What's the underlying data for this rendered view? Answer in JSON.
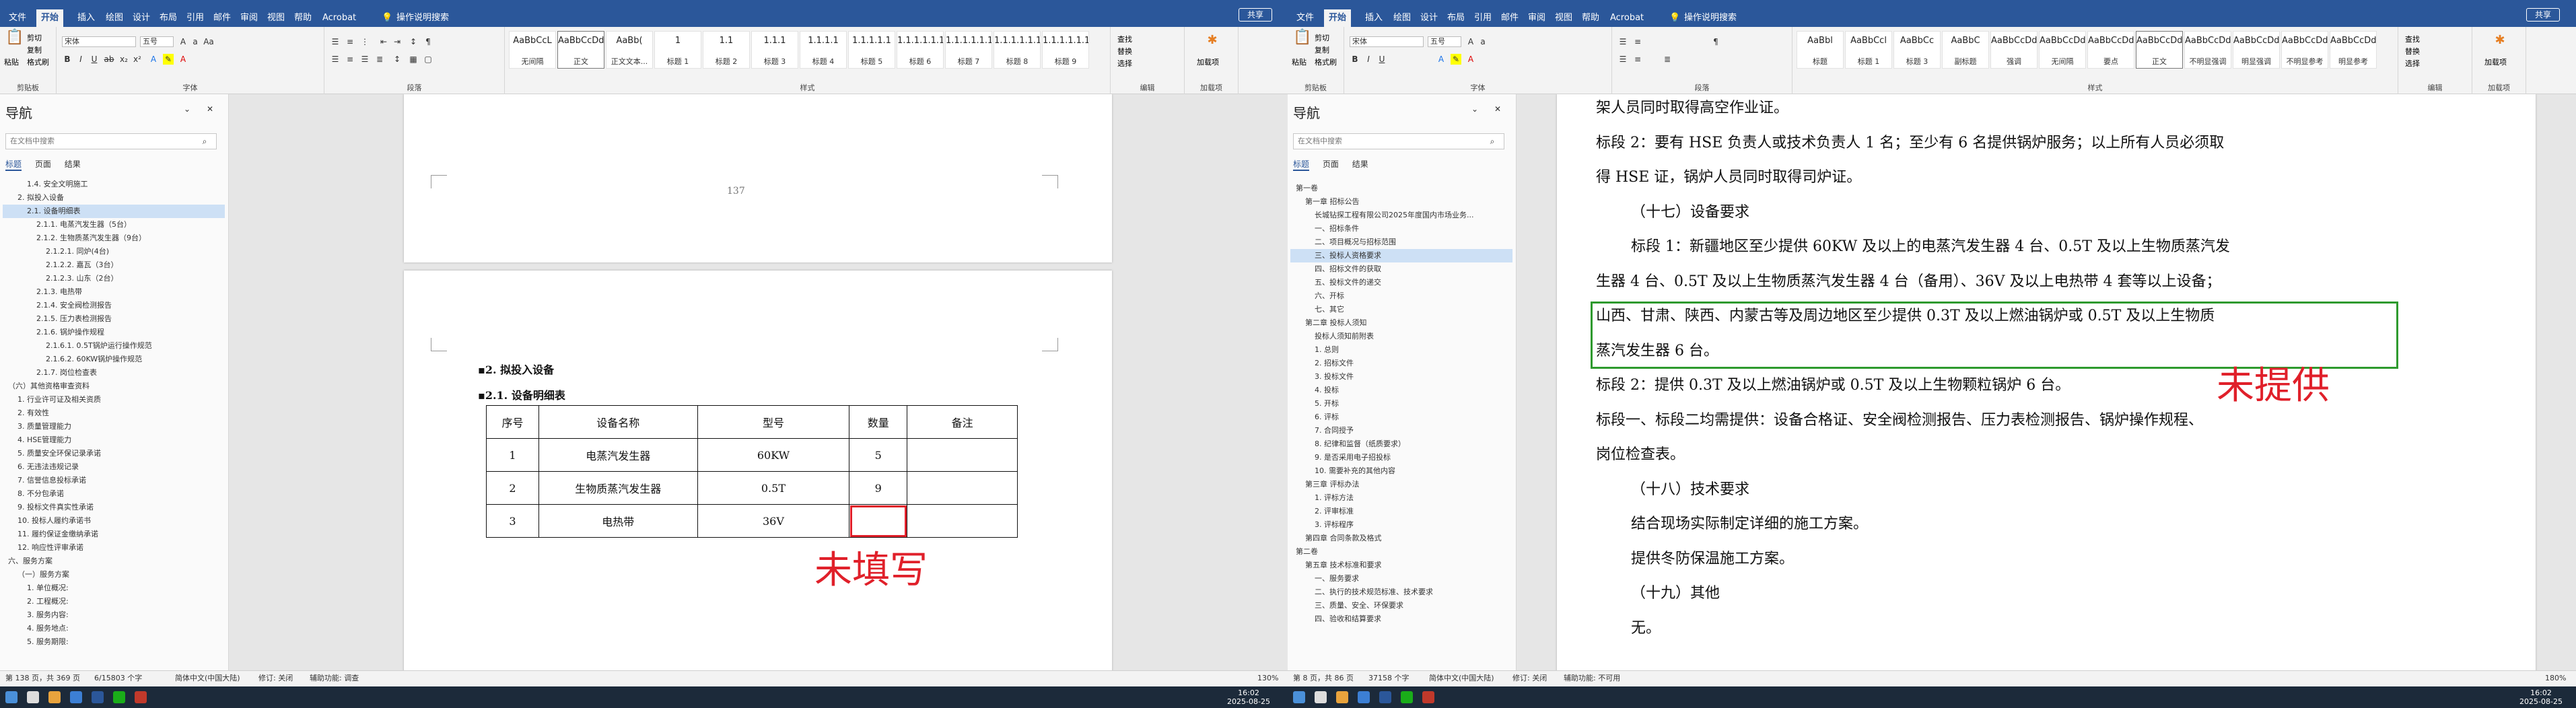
{
  "menu": {
    "tabs": [
      "文件",
      "开始",
      "插入",
      "绘图",
      "设计",
      "布局",
      "引用",
      "邮件",
      "审阅",
      "视图",
      "帮助",
      "Acrobat"
    ],
    "search_hint": "操作说明搜索",
    "share": "共享"
  },
  "ribbon": {
    "clipboard": {
      "paste": "粘贴",
      "cut": "剪切",
      "copy": "复制",
      "format_painter": "格式刷",
      "label": "剪贴板"
    },
    "font": {
      "name": "宋体",
      "size": "五号",
      "label": "字体"
    },
    "paragraph": {
      "label": "段落"
    },
    "styles_label": "样式",
    "editing": {
      "find": "查找",
      "replace": "替换",
      "select": "选择",
      "label": "编辑"
    },
    "addin": {
      "label": "加载项",
      "btn": "加载项"
    }
  },
  "left": {
    "styles": [
      {
        "prev": "AaBbCcL",
        "name": "无间隔"
      },
      {
        "prev": "AaBbCcDd",
        "name": "正文"
      },
      {
        "prev": "AaBb(",
        "name": "正文文本..."
      },
      {
        "prev": "1",
        "name": "标题 1"
      },
      {
        "prev": "1.1",
        "name": "标题 2"
      },
      {
        "prev": "1.1.1",
        "name": "标题 3"
      },
      {
        "prev": "1.1.1.1",
        "name": "标题 4"
      },
      {
        "prev": "1.1.1.1.1",
        "name": "标题 5"
      },
      {
        "prev": "1.1.1.1.1.1",
        "name": "标题 6"
      },
      {
        "prev": "1.1.1.1.1.1.",
        "name": "标题 7"
      },
      {
        "prev": "1.1.1.1.1.1.",
        "name": "标题 8"
      },
      {
        "prev": "1.1.1.1.1.1.",
        "name": "标题 9"
      }
    ],
    "nav": {
      "title": "导航",
      "search_placeholder": "在文档中搜索",
      "tabs": [
        "标题",
        "页面",
        "结果"
      ],
      "items": [
        {
          "text": "1.4. 安全文明施工",
          "indent": 2
        },
        {
          "text": "2. 拟投入设备",
          "indent": 1
        },
        {
          "text": "2.1. 设备明细表",
          "indent": 2,
          "on": true
        },
        {
          "text": "2.1.1. 电蒸汽发生器（5台）",
          "indent": 3
        },
        {
          "text": "2.1.2. 生物质蒸汽发生器（9台）",
          "indent": 3
        },
        {
          "text": "2.1.2.1. 同炉(4台)",
          "indent": 4
        },
        {
          "text": "2.1.2.2. 嘉瓦（3台）",
          "indent": 4
        },
        {
          "text": "2.1.2.3. 山东（2台）",
          "indent": 4
        },
        {
          "text": "2.1.3. 电热带",
          "indent": 3
        },
        {
          "text": "2.1.4. 安全阀检测报告",
          "indent": 3
        },
        {
          "text": "2.1.5. 压力表检测报告",
          "indent": 3
        },
        {
          "text": "2.1.6. 锅炉操作规程",
          "indent": 3
        },
        {
          "text": "2.1.6.1. 0.5T锅炉运行操作规范",
          "indent": 4
        },
        {
          "text": "2.1.6.2. 60KW锅炉操作规范",
          "indent": 4
        },
        {
          "text": "2.1.7. 岗位检查表",
          "indent": 3
        },
        {
          "text": "（六）其他资格审查资料",
          "indent": 0
        },
        {
          "text": "1. 行业许可证及相关资质",
          "indent": 1
        },
        {
          "text": "2. 有效性",
          "indent": 1
        },
        {
          "text": "3. 质量管理能力",
          "indent": 1
        },
        {
          "text": "4. HSE管理能力",
          "indent": 1
        },
        {
          "text": "5. 质量安全环保记录承诺",
          "indent": 1
        },
        {
          "text": "6. 无违法违规记录",
          "indent": 1
        },
        {
          "text": "7. 信誉信息投标承诺",
          "indent": 1
        },
        {
          "text": "8. 不分包承诺",
          "indent": 1
        },
        {
          "text": "9. 投标文件真实性承诺",
          "indent": 1
        },
        {
          "text": "10. 投标人履约承诺书",
          "indent": 1
        },
        {
          "text": "11. 履约保证金缴纳承诺",
          "indent": 1
        },
        {
          "text": "12. 响应性评审承诺",
          "indent": 1
        },
        {
          "text": "六、服务方案",
          "indent": 0
        },
        {
          "text": "（一）服务方案",
          "indent": 1
        },
        {
          "text": "1. 单位概况:",
          "indent": 2
        },
        {
          "text": "2. 工程概况:",
          "indent": 2
        },
        {
          "text": "3. 服务内容:",
          "indent": 2
        },
        {
          "text": "4. 服务地点:",
          "indent": 2
        },
        {
          "text": "5. 服务期限:",
          "indent": 2
        }
      ]
    },
    "page_number": "137",
    "headings": {
      "h1": "2. 拟投入设备",
      "h2": "2.1. 设备明细表"
    },
    "table": {
      "headers": [
        "序号",
        "设备名称",
        "型号",
        "数量",
        "备注"
      ],
      "rows": [
        [
          "1",
          "电蒸汽发生器",
          "60KW",
          "5",
          ""
        ],
        [
          "2",
          "生物质蒸汽发生器",
          "0.5T",
          "9",
          ""
        ],
        [
          "3",
          "电热带",
          "36V",
          "",
          ""
        ]
      ]
    },
    "annotation": "未填写",
    "status": {
      "page": "第 138 页，共 369 页",
      "words": "6/15803 个字",
      "lang": "简体中文(中国大陆)",
      "revise": "修订: 关闭",
      "access": "辅助功能: 调查",
      "zoom": "130%"
    }
  },
  "right": {
    "styles": [
      {
        "prev": "AaBbl",
        "name": "标题"
      },
      {
        "prev": "AaBbCcl",
        "name": "标题 1"
      },
      {
        "prev": "AaBbCc",
        "name": "标题 3"
      },
      {
        "prev": "AaBbC",
        "name": "副标题"
      },
      {
        "prev": "AaBbCcDd",
        "name": "强调"
      },
      {
        "prev": "AaBbCcDd",
        "name": "无间隔"
      },
      {
        "prev": "AaBbCcDd",
        "name": "要点"
      },
      {
        "prev": "AaBbCcDd",
        "name": "正文"
      },
      {
        "prev": "AaBbCcDd",
        "name": "不明显强调"
      },
      {
        "prev": "AaBbCcDd",
        "name": "明显强调"
      },
      {
        "prev": "AaBbCcDd",
        "name": "不明显参考"
      },
      {
        "prev": "AaBbCcDd",
        "name": "明显参考"
      }
    ],
    "nav": {
      "title": "导航",
      "search_placeholder": "在文档中搜索",
      "tabs": [
        "标题",
        "页面",
        "结果"
      ],
      "items": [
        {
          "text": "第一卷",
          "indent": 0
        },
        {
          "text": "第一章 招标公告",
          "indent": 1
        },
        {
          "text": "长城钻探工程有限公司2025年度国内市场业务...",
          "indent": 2
        },
        {
          "text": "一、招标条件",
          "indent": 2
        },
        {
          "text": "二、项目概况与招标范围",
          "indent": 2
        },
        {
          "text": "三、投标人资格要求",
          "indent": 2,
          "on": true
        },
        {
          "text": "四、招标文件的获取",
          "indent": 2
        },
        {
          "text": "五、投标文件的递交",
          "indent": 2
        },
        {
          "text": "六、开标",
          "indent": 2
        },
        {
          "text": "七、其它",
          "indent": 2
        },
        {
          "text": "第二章 投标人须知",
          "indent": 1
        },
        {
          "text": "投标人须知前附表",
          "indent": 2
        },
        {
          "text": "1. 总则",
          "indent": 2
        },
        {
          "text": "2. 招标文件",
          "indent": 2
        },
        {
          "text": "3. 投标文件",
          "indent": 2
        },
        {
          "text": "4. 投标",
          "indent": 2
        },
        {
          "text": "5. 开标",
          "indent": 2
        },
        {
          "text": "6. 评标",
          "indent": 2
        },
        {
          "text": "7. 合同授予",
          "indent": 2
        },
        {
          "text": "8. 纪律和监督（纸质要求）",
          "indent": 2
        },
        {
          "text": "9. 是否采用电子招投标",
          "indent": 2
        },
        {
          "text": "10. 需要补充的其他内容",
          "indent": 2
        },
        {
          "text": "第三章 评标办法",
          "indent": 1
        },
        {
          "text": "1. 评标方法",
          "indent": 2
        },
        {
          "text": "2. 评审标准",
          "indent": 2
        },
        {
          "text": "3. 评标程序",
          "indent": 2
        },
        {
          "text": "第四章 合同条款及格式",
          "indent": 1
        },
        {
          "text": "第二卷",
          "indent": 0
        },
        {
          "text": "第五章 技术标准和要求",
          "indent": 1
        },
        {
          "text": "一、服务要求",
          "indent": 2
        },
        {
          "text": "二、执行的技术规范标准、技术要求",
          "indent": 2
        },
        {
          "text": "三、质量、安全、环保要求",
          "indent": 2
        },
        {
          "text": "四、验收和结算要求",
          "indent": 2
        }
      ]
    },
    "lines": [
      {
        "text": "架人员同时取得高空作业证。",
        "x": 0
      },
      {
        "text": "标段 2：要有 HSE 负责人或技术负责人 1 名；至少有 6 名提供锅炉服务；以上所有人员必须取",
        "x": 0
      },
      {
        "text": "得 HSE 证，锅炉人员同时取得司炉证。",
        "x": 0
      },
      {
        "text": "（十七）设备要求",
        "x": 1
      },
      {
        "text": "标段 1：新疆地区至少提供 60KW 及以上的电蒸汽发生器 4 台、0.5T 及以上生物质蒸汽发",
        "x": 1
      },
      {
        "text": "生器 4 台、0.5T 及以上生物质蒸汽发生器 4 台（备用）、36V 及以上电热带 4 套等以上设备；",
        "x": 0
      },
      {
        "text": "山西、甘肃、陕西、内蒙古等及周边地区至少提供 0.3T 及以上燃油锅炉或 0.5T 及以上生物质",
        "x": 0
      },
      {
        "text": "蒸汽发生器 6 台。",
        "x": 0
      },
      {
        "text": "标段 2：提供 0.3T 及以上燃油锅炉或 0.5T 及以上生物颗粒锅炉 6 台。",
        "x": 0
      },
      {
        "text": "标段一、标段二均需提供：设备合格证、安全阀检测报告、压力表检测报告、锅炉操作规程、",
        "x": 0
      },
      {
        "text": "岗位检查表。",
        "x": 0
      },
      {
        "text": "（十八）技术要求",
        "x": 1
      },
      {
        "text": "结合现场实际制定详细的施工方案。",
        "x": 1
      },
      {
        "text": "提供冬防保温施工方案。",
        "x": 1
      },
      {
        "text": "（十九）其他",
        "x": 1
      },
      {
        "text": "无。",
        "x": 1
      }
    ],
    "annotation": "未提供",
    "status": {
      "page": "第 8 页，共 86 页",
      "words": "37158 个字",
      "lang": "简体中文(中国大陆)",
      "revise": "修订: 关闭",
      "access": "辅助功能: 不可用",
      "zoom": "180%"
    }
  },
  "taskbar": {
    "left_time": "16:02",
    "left_date": "2025-08-25",
    "right_time": "16:02",
    "right_date": "2025-08-25"
  },
  "colors": {
    "brand": "#2b579a",
    "annotation_red": "#e0202a",
    "highlight_green": "#2e9a2e"
  }
}
